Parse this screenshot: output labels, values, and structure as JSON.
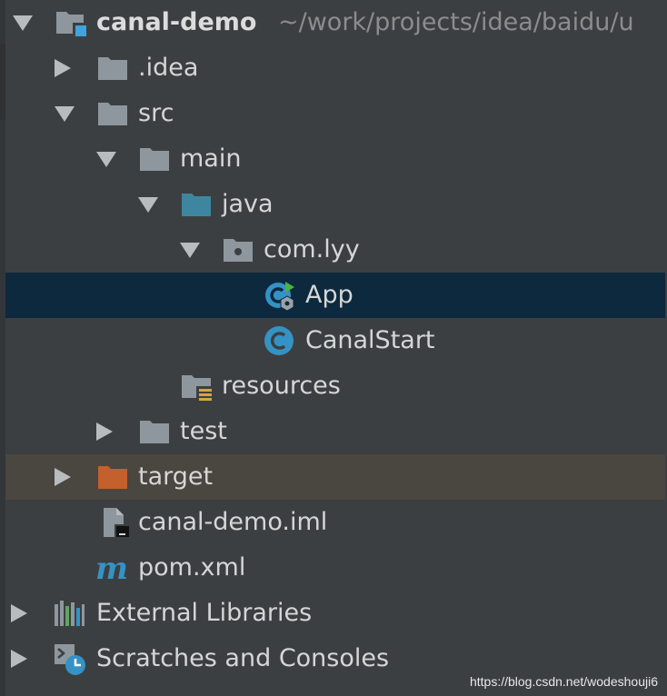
{
  "project": {
    "name": "canal-demo",
    "path": "~/work/projects/idea/baidu/u"
  },
  "tree": {
    "idea": ".idea",
    "src": "src",
    "main": "main",
    "java": "java",
    "package": "com.lyy",
    "app": "App",
    "canal_start": "CanalStart",
    "resources": "resources",
    "test": "test",
    "target": "target",
    "iml": "canal-demo.iml",
    "pom": "pom.xml",
    "external_libraries": "External Libraries",
    "scratches": "Scratches and Consoles"
  },
  "watermark": "https://blog.csdn.net/wodeshouji6",
  "colors": {
    "background": "#3c3f41",
    "selected_row": "#0d293e",
    "excluded_row": "#4a4640",
    "folder": "#8e979e",
    "source_folder": "#3e86a0",
    "excluded_folder": "#c3602b",
    "class_icon": "#3592c4"
  }
}
